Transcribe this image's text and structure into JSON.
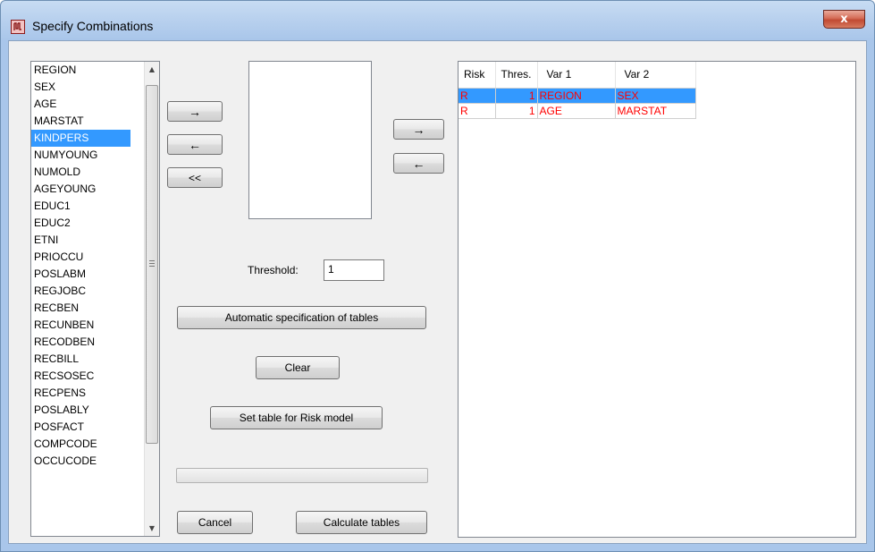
{
  "window": {
    "title": "Specify Combinations",
    "close_label": "x"
  },
  "variables": {
    "items": [
      "REGION",
      "SEX",
      "AGE",
      "MARSTAT",
      "KINDPERS",
      "NUMYOUNG",
      "NUMOLD",
      "AGEYOUNG",
      "EDUC1",
      "EDUC2",
      "ETNI",
      "PRIOCCU",
      "POSLABM",
      "REGJOBC",
      "RECBEN",
      "RECUNBEN",
      "RECODBEN",
      "RECBILL",
      "RECSOSEC",
      "RECPENS",
      "POSLABLY",
      "POSFACT",
      "COMPCODE",
      "OCCUCODE"
    ],
    "selected": "KINDPERS"
  },
  "buttons": {
    "add_var": "→",
    "remove_var": "←",
    "remove_all": "<<",
    "add_table": "→",
    "remove_table": "←",
    "auto_spec": "Automatic specification of tables",
    "clear": "Clear",
    "set_risk": "Set table for Risk model",
    "cancel": "Cancel",
    "calculate": "Calculate tables"
  },
  "threshold": {
    "label": "Threshold:",
    "value": "1"
  },
  "progress": {
    "value": 0
  },
  "tables": {
    "headers": [
      "Risk",
      "Thres.",
      "Var 1",
      "Var 2"
    ],
    "rows": [
      {
        "risk": "R",
        "thres": "1",
        "var1": "REGION",
        "var2": "SEX",
        "selected": true
      },
      {
        "risk": "R",
        "thres": "1",
        "var1": "AGE",
        "var2": "MARSTAT",
        "selected": false
      }
    ]
  },
  "colors": {
    "selection": "#3399ff",
    "table_text": "#ff0000"
  },
  "icons": {
    "app": "mu-argus-icon",
    "close": "close-icon"
  }
}
